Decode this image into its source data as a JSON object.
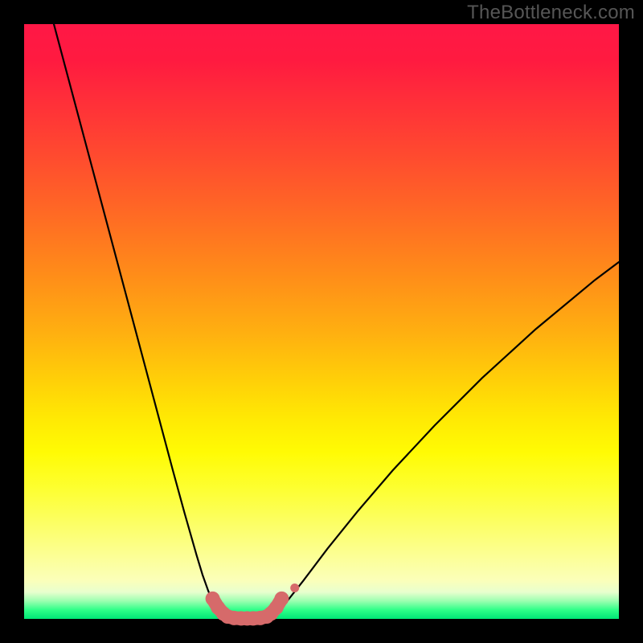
{
  "watermark": "TheBottleneck.com",
  "colors": {
    "frame": "#000000",
    "curve": "#000000",
    "marker_fill": "#d66a6a",
    "marker_stroke": "#c85a5a"
  },
  "chart_data": {
    "type": "line",
    "title": "",
    "xlabel": "",
    "ylabel": "",
    "xlim": [
      0,
      100
    ],
    "ylim": [
      0,
      100
    ],
    "grid": false,
    "series": [
      {
        "name": "curve-left",
        "x": [
          5,
          7,
          9,
          11,
          13,
          15,
          17,
          19,
          21,
          23,
          25,
          27,
          29,
          30,
          31,
          32,
          33,
          34
        ],
        "y": [
          100,
          92.5,
          85,
          77.5,
          70,
          62.5,
          55,
          47.5,
          40,
          32.5,
          25,
          17.7,
          10.7,
          7.4,
          4.6,
          2.4,
          0.9,
          0.15
        ]
      },
      {
        "name": "curve-floor",
        "x": [
          34,
          35,
          36,
          37,
          38,
          39,
          40,
          41
        ],
        "y": [
          0.15,
          0.05,
          0,
          0,
          0,
          0,
          0.05,
          0.15
        ]
      },
      {
        "name": "curve-right",
        "x": [
          41,
          42,
          44,
          47,
          51,
          56,
          62,
          69,
          77,
          86,
          96,
          100
        ],
        "y": [
          0.15,
          0.7,
          2.7,
          6.5,
          11.8,
          18.0,
          25.0,
          32.5,
          40.5,
          48.7,
          57.0,
          60.0
        ]
      }
    ],
    "markers": {
      "name": "bottleneck-zone",
      "points": [
        {
          "x": 31.7,
          "y": 3.4
        },
        {
          "x": 32.6,
          "y": 1.9
        },
        {
          "x": 33.5,
          "y": 0.9
        },
        {
          "x": 34.2,
          "y": 0.4
        },
        {
          "x": 35.3,
          "y": 0.15
        },
        {
          "x": 36.5,
          "y": 0.08
        },
        {
          "x": 37.5,
          "y": 0.08
        },
        {
          "x": 38.5,
          "y": 0.08
        },
        {
          "x": 39.7,
          "y": 0.15
        },
        {
          "x": 40.8,
          "y": 0.4
        },
        {
          "x": 41.5,
          "y": 0.9
        },
        {
          "x": 42.4,
          "y": 1.9
        },
        {
          "x": 43.3,
          "y": 3.4
        }
      ],
      "extra": {
        "x": 45.5,
        "y": 5.2
      }
    }
  }
}
